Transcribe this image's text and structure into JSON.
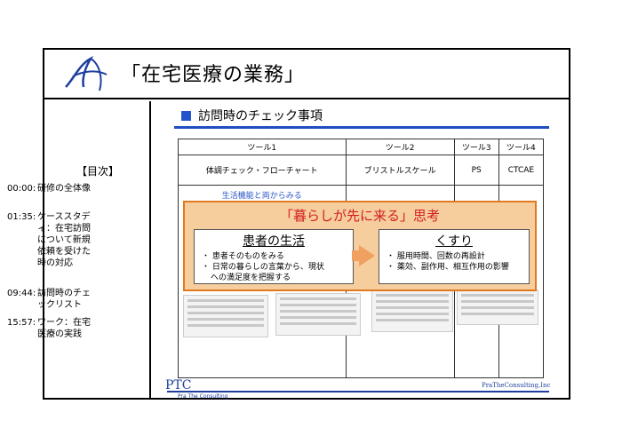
{
  "slide": {
    "title": "「在宅医療の業務」",
    "logo_letter": "A"
  },
  "toc": {
    "heading": "【目次】",
    "items": [
      {
        "time": "00:00:",
        "desc": "研修の全体像"
      },
      {
        "time": "01:35:",
        "desc": "ケーススタディ：在宅訪問について新規依頼を受けた時の対応"
      },
      {
        "time": "09:44:",
        "desc": "訪問時のチェックリスト"
      },
      {
        "time": "15:57:",
        "desc": "ワーク：在宅医療の実践"
      }
    ]
  },
  "main": {
    "heading": "訪問時のチェック事項",
    "tools_header": [
      "ツール1",
      "ツール2",
      "ツール3",
      "ツール4"
    ],
    "tools_row": [
      "体調チェック・フローチャート",
      "ブリストルスケール",
      "PS",
      "CTCAE"
    ],
    "faded_text": "生活機能と両からみる"
  },
  "overlay": {
    "title": "「暮らしが先に来る」思考",
    "left_box": {
      "title": "患者の生活",
      "bullets": [
        "・ 患者そのものをみる",
        "・ 日常の暮らしの言葉から、現状",
        "への満足度を把握する"
      ]
    },
    "right_box": {
      "title": "くすり",
      "bullets": [
        "・ 服用時間、回数の再設計",
        "・ 薬効、副作用、相互作用の影響"
      ]
    }
  },
  "footer": {
    "logo_text": "PTC",
    "logo_sub": "Pra The Consulting",
    "company": "PraTheConsulting,Inc"
  },
  "colors": {
    "accent_blue": "#1f4fbf",
    "overlay_bg": "#f6cd9c",
    "overlay_border": "#e07a22",
    "title_red": "#d12020"
  }
}
